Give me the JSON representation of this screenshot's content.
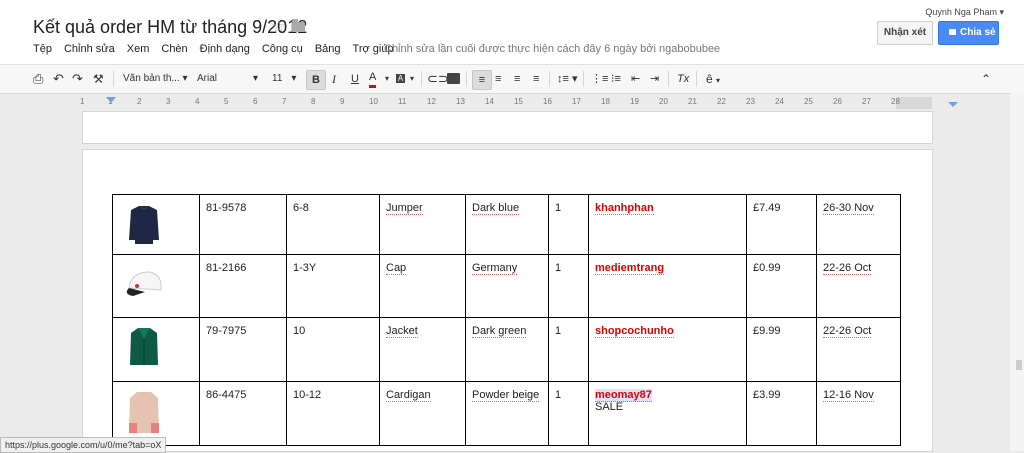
{
  "header": {
    "title": "Kết quả order HM từ tháng 9/2012",
    "user": "Quynh Nga Pham",
    "comment_button": "Nhận xét",
    "share_button": "Chia sẻ",
    "last_edit": "Chỉnh sửa lần cuối được thực hiện cách đây 6 ngày bởi ngabobubee"
  },
  "menu": [
    "Tệp",
    "Chỉnh sửa",
    "Xem",
    "Chèn",
    "Định dạng",
    "Công cụ",
    "Bảng",
    "Trợ giúp"
  ],
  "toolbar": {
    "style": "Văn bản th...",
    "font": "Arial",
    "size": "11",
    "bold": "B",
    "italic": "I",
    "underline": "U",
    "text_color": "A",
    "highlight": "A",
    "clear_format": "Tx",
    "input_tools": "ê"
  },
  "ruler": [
    "1",
    "1",
    "2",
    "3",
    "4",
    "5",
    "6",
    "7",
    "8",
    "9",
    "10",
    "11",
    "12",
    "13",
    "14",
    "15",
    "16",
    "17",
    "18",
    "19",
    "20",
    "21",
    "22",
    "23",
    "24",
    "25",
    "26",
    "27",
    "28"
  ],
  "rows": [
    {
      "code": "81-9578",
      "size": "6-8",
      "item": "Jumper",
      "color": "Dark blue",
      "qty": "1",
      "buyer": "khanhphan",
      "note": "",
      "price": "£7.49",
      "date": "26-30 Nov"
    },
    {
      "code": "81-2166",
      "size": "1-3Y",
      "item": "Cap",
      "color": "Germany",
      "qty": "1",
      "buyer": "mediemtrang",
      "note": "",
      "price": "£0.99",
      "date": "22-26 Oct"
    },
    {
      "code": "79-7975",
      "size": "10",
      "item": "Jacket",
      "color": "Dark green",
      "qty": "1",
      "buyer": "shopcochunho",
      "note": "",
      "price": "£9.99",
      "date": "22-26 Oct"
    },
    {
      "code": "86-4475",
      "size": "10-12",
      "item": "Cardigan",
      "color": "Powder beige",
      "qty": "1",
      "buyer": "meomay87",
      "note": "SALE",
      "price": "£3.99",
      "date": "12-16 Nov"
    }
  ],
  "status_url": "https://plus.google.com/u/0/me?tab=oX",
  "colors": {
    "accent": "#4a8af4",
    "buyer": "#dd0000"
  }
}
